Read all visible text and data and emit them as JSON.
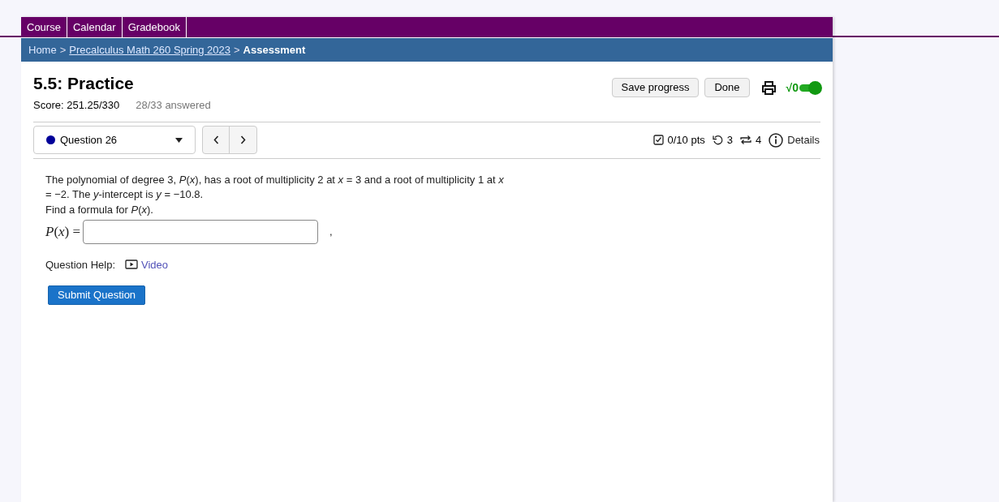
{
  "nav_tabs": [
    "Course",
    "Calendar",
    "Gradebook"
  ],
  "breadcrumb_separator": ">",
  "breadcrumb": [
    {
      "label": "Home",
      "link": false
    },
    {
      "label": "Precalculus Math 260 Spring 2023",
      "link": true
    },
    {
      "label": "Assessment",
      "link": false
    }
  ],
  "assessment": {
    "title": "5.5: Practice",
    "score": "Score: 251.25/330",
    "answered": "28/33 answered"
  },
  "buttons": [
    "Save progress",
    "Done"
  ],
  "math_toggle": {
    "label": "√0",
    "on": true
  },
  "question_select": {
    "label": "Question 26",
    "color": "#000099"
  },
  "question_info": {
    "points": "0/10 pts",
    "retries": "3",
    "attempts": "4",
    "details": "Details"
  },
  "question": {
    "text": "The polynomial of degree 3, *P*(*x*), has a root of multiplicity 2 at *x* = 3 and a root of multiplicity 1 at *x* = −2. The *y*-intercept is *y* = −10.8.",
    "prompt": "Find a formula for *P*(*x*).",
    "answer_label": "*P*(*x*) =",
    "after_field": ",",
    "help_label": "Question Help:",
    "help_link": "Video",
    "submit": "Submit Question"
  }
}
